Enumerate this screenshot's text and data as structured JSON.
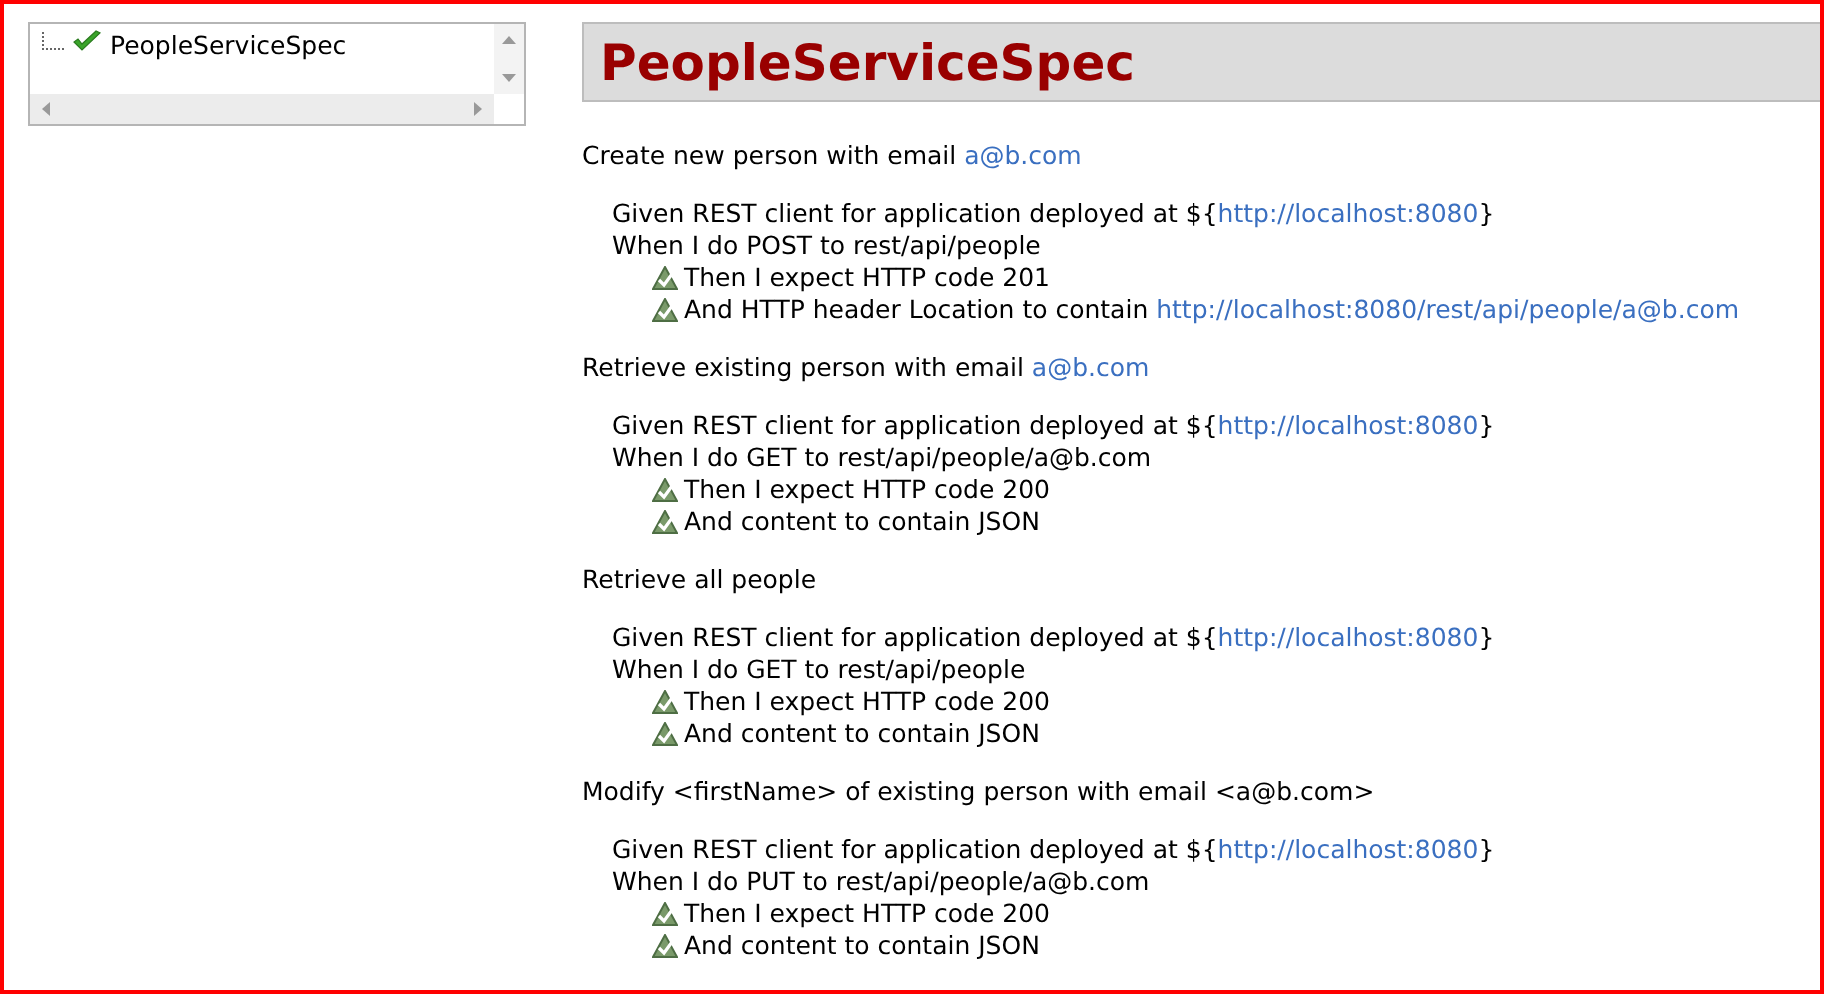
{
  "tree": {
    "items": [
      {
        "label": "PeopleServiceSpec",
        "selected": false
      }
    ]
  },
  "spec": {
    "title": "PeopleServiceSpec",
    "scenarios": [
      {
        "title": "Create new person with email ",
        "link": "a@b.com",
        "steps": [
          {
            "kind": "plain",
            "text": "Given REST client for application deployed at ${",
            "link": "http://localhost:8080",
            "suffix": "}"
          },
          {
            "kind": "plain",
            "text": "When I do POST to rest/api/people"
          },
          {
            "kind": "check",
            "text": "Then I expect HTTP code 201"
          },
          {
            "kind": "check",
            "text": "And HTTP header Location to contain ",
            "link": "http://localhost:8080/rest/api/people/a@b.com"
          }
        ]
      },
      {
        "title": "Retrieve existing person with email ",
        "link": "a@b.com",
        "steps": [
          {
            "kind": "plain",
            "text": "Given REST client for application deployed at ${",
            "link": "http://localhost:8080",
            "suffix": "}"
          },
          {
            "kind": "plain",
            "text": "When I do GET to rest/api/people/a@b.com"
          },
          {
            "kind": "check",
            "text": "Then I expect HTTP code 200"
          },
          {
            "kind": "check",
            "text": "And content to contain JSON"
          }
        ]
      },
      {
        "title": "Retrieve all people",
        "steps": [
          {
            "kind": "plain",
            "text": "Given REST client for application deployed at ${",
            "link": "http://localhost:8080",
            "suffix": "}"
          },
          {
            "kind": "plain",
            "text": "When I do GET to rest/api/people"
          },
          {
            "kind": "check",
            "text": "Then I expect HTTP code 200"
          },
          {
            "kind": "check",
            "text": "And content to contain JSON"
          }
        ]
      },
      {
        "title": "Modify <firstName> of existing person with email <a@b.com>",
        "steps": [
          {
            "kind": "plain",
            "text": "Given REST client for application deployed at ${",
            "link": "http://localhost:8080",
            "suffix": "}"
          },
          {
            "kind": "plain",
            "text": "When I do PUT to rest/api/people/a@b.com"
          },
          {
            "kind": "check",
            "text": "Then I expect HTTP code 200"
          },
          {
            "kind": "check",
            "text": "And content to contain JSON"
          }
        ]
      }
    ]
  }
}
